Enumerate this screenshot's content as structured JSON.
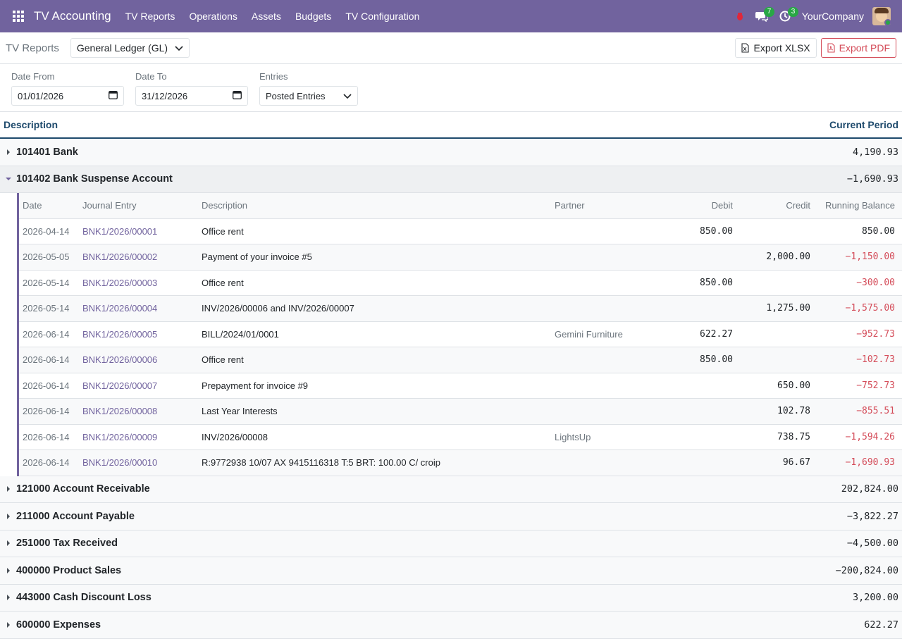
{
  "navbar": {
    "brand": "TV Accounting",
    "menu": [
      "TV Reports",
      "Operations",
      "Assets",
      "Budgets",
      "TV Configuration"
    ],
    "messages_count": "7",
    "activities_count": "3",
    "company": "YourCompany",
    "accent_color": "#71639e"
  },
  "control_panel": {
    "breadcrumb": "TV Reports",
    "report_select": "General Ledger (GL)",
    "export_xlsx": "Export XLSX",
    "export_pdf": "Export PDF"
  },
  "filters": {
    "date_from_label": "Date From",
    "date_from_value": "01/01/2026",
    "date_to_label": "Date To",
    "date_to_value": "31/12/2026",
    "entries_label": "Entries",
    "entries_value": "Posted Entries"
  },
  "report": {
    "col_description": "Description",
    "col_current_period": "Current Period",
    "accounts_before": [
      {
        "name": "101401 Bank",
        "amount": "4,190.93"
      }
    ],
    "expanded_account": {
      "name": "101402 Bank Suspense Account",
      "amount": "−1,690.93"
    },
    "detail_headers": {
      "date": "Date",
      "journal_entry": "Journal Entry",
      "description": "Description",
      "partner": "Partner",
      "debit": "Debit",
      "credit": "Credit",
      "running_balance": "Running Balance"
    },
    "lines": [
      {
        "date": "2026-04-14",
        "je": "BNK1/2026/00001",
        "desc": "Office rent",
        "partner": "",
        "debit": "850.00",
        "credit": "",
        "balance": "850.00"
      },
      {
        "date": "2026-05-05",
        "je": "BNK1/2026/00002",
        "desc": "Payment of your invoice #5",
        "partner": "",
        "debit": "",
        "credit": "2,000.00",
        "balance": "−1,150.00"
      },
      {
        "date": "2026-05-14",
        "je": "BNK1/2026/00003",
        "desc": "Office rent",
        "partner": "",
        "debit": "850.00",
        "credit": "",
        "balance": "−300.00"
      },
      {
        "date": "2026-05-14",
        "je": "BNK1/2026/00004",
        "desc": "INV/2026/00006 and INV/2026/00007",
        "partner": "",
        "debit": "",
        "credit": "1,275.00",
        "balance": "−1,575.00"
      },
      {
        "date": "2026-06-14",
        "je": "BNK1/2026/00005",
        "desc": "BILL/2024/01/0001",
        "partner": "Gemini Furniture",
        "debit": "622.27",
        "credit": "",
        "balance": "−952.73"
      },
      {
        "date": "2026-06-14",
        "je": "BNK1/2026/00006",
        "desc": "Office rent",
        "partner": "",
        "debit": "850.00",
        "credit": "",
        "balance": "−102.73"
      },
      {
        "date": "2026-06-14",
        "je": "BNK1/2026/00007",
        "desc": "Prepayment for invoice #9",
        "partner": "",
        "debit": "",
        "credit": "650.00",
        "balance": "−752.73"
      },
      {
        "date": "2026-06-14",
        "je": "BNK1/2026/00008",
        "desc": "Last Year Interests",
        "partner": "",
        "debit": "",
        "credit": "102.78",
        "balance": "−855.51"
      },
      {
        "date": "2026-06-14",
        "je": "BNK1/2026/00009",
        "desc": "INV/2026/00008",
        "partner": "LightsUp",
        "debit": "",
        "credit": "738.75",
        "balance": "−1,594.26"
      },
      {
        "date": "2026-06-14",
        "je": "BNK1/2026/00010",
        "desc": "R:9772938 10/07 AX 9415116318 T:5 BRT: 100.00 C/ croip",
        "partner": "",
        "debit": "",
        "credit": "96.67",
        "balance": "−1,690.93"
      }
    ],
    "accounts_after": [
      {
        "name": "121000 Account Receivable",
        "amount": "202,824.00"
      },
      {
        "name": "211000 Account Payable",
        "amount": "−3,822.27"
      },
      {
        "name": "251000 Tax Received",
        "amount": "−4,500.00"
      },
      {
        "name": "400000 Product Sales",
        "amount": "−200,824.00"
      },
      {
        "name": "443000 Cash Discount Loss",
        "amount": "3,200.00"
      },
      {
        "name": "600000 Expenses",
        "amount": "622.27"
      }
    ]
  }
}
